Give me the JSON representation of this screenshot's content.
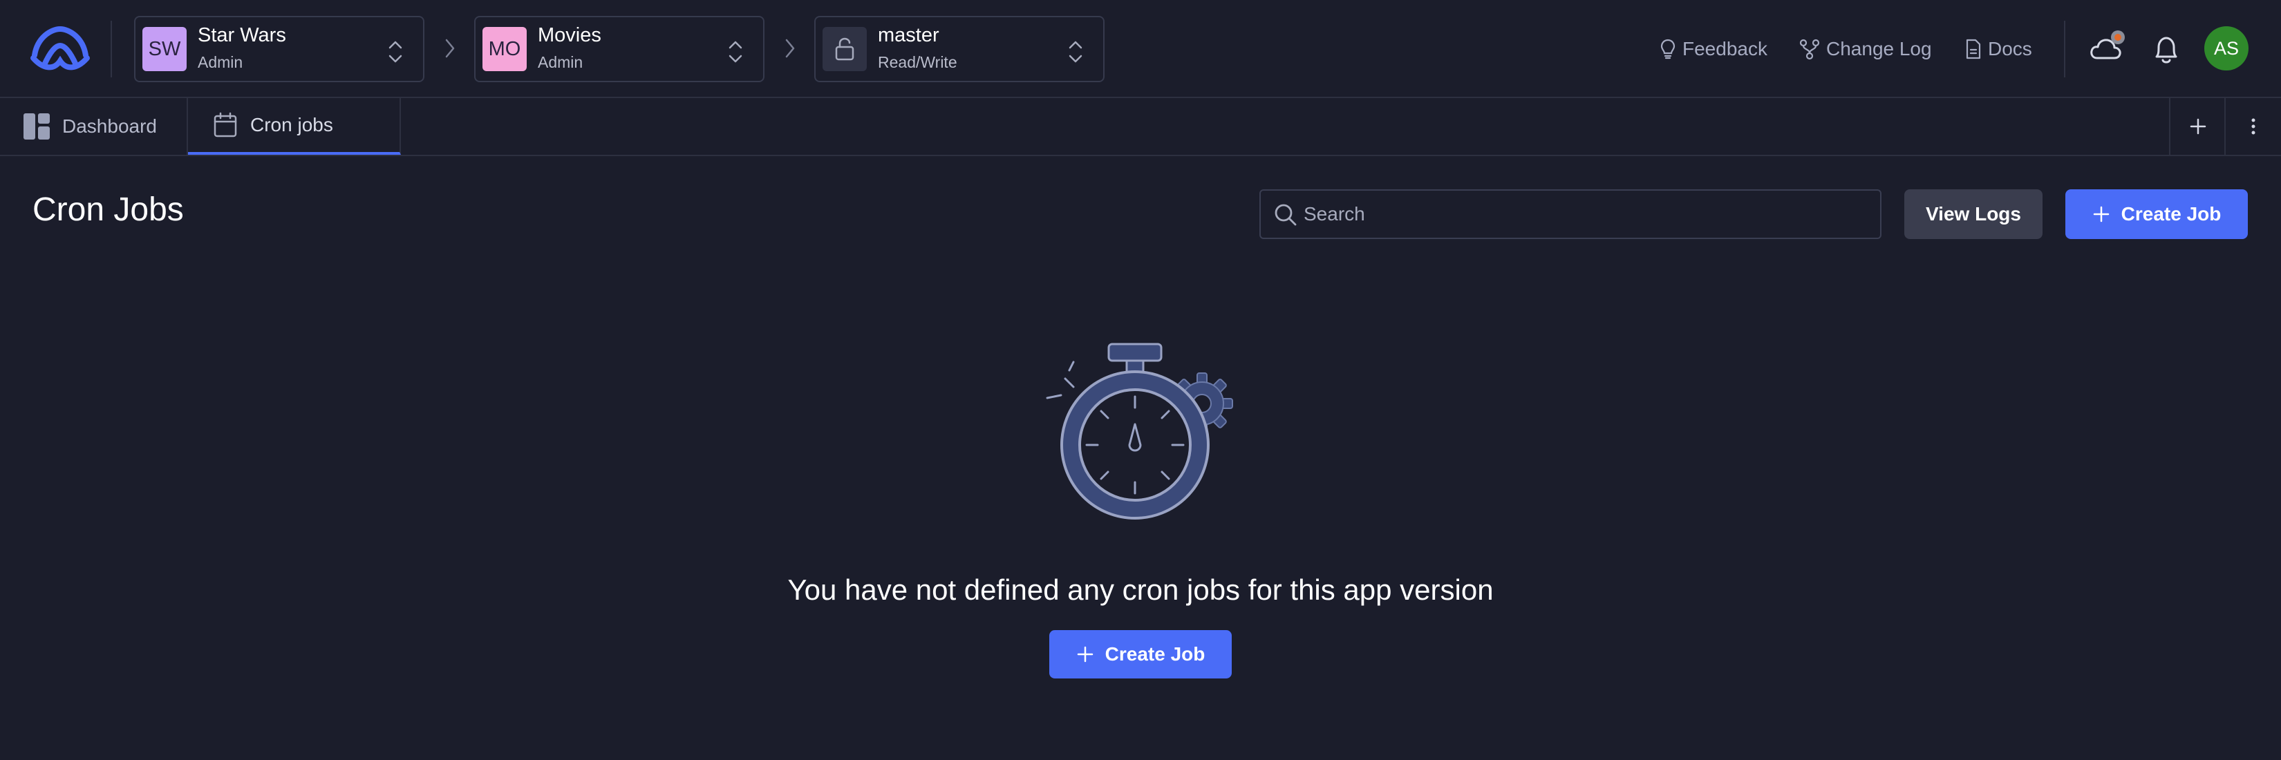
{
  "header": {
    "org": {
      "initials": "SW",
      "name": "Star Wars",
      "role": "Admin",
      "badge_color": "#c59ef5"
    },
    "app": {
      "initials": "MO",
      "name": "Movies",
      "role": "Admin",
      "badge_color": "#f5a6d9"
    },
    "branch": {
      "name": "master",
      "access": "Read/Write",
      "icon": "lock-open-icon"
    },
    "links": [
      {
        "label": "Feedback",
        "icon": "lightbulb-icon"
      },
      {
        "label": "Change Log",
        "icon": "git-branch-icon"
      },
      {
        "label": "Docs",
        "icon": "document-icon"
      }
    ],
    "user_initials": "AS",
    "accent": "#4a6cf7"
  },
  "tabs": [
    {
      "label": "Dashboard",
      "icon": "dashboard-icon",
      "active": false
    },
    {
      "label": "Cron jobs",
      "icon": "calendar-icon",
      "active": true
    }
  ],
  "main": {
    "title": "Cron Jobs",
    "search_placeholder": "Search",
    "view_logs_label": "View Logs",
    "create_job_label": "Create Job",
    "empty_message": "You have not defined any cron jobs for this app version",
    "empty_create_label": "Create Job",
    "empty_icon": "stopwatch-gear-icon"
  }
}
